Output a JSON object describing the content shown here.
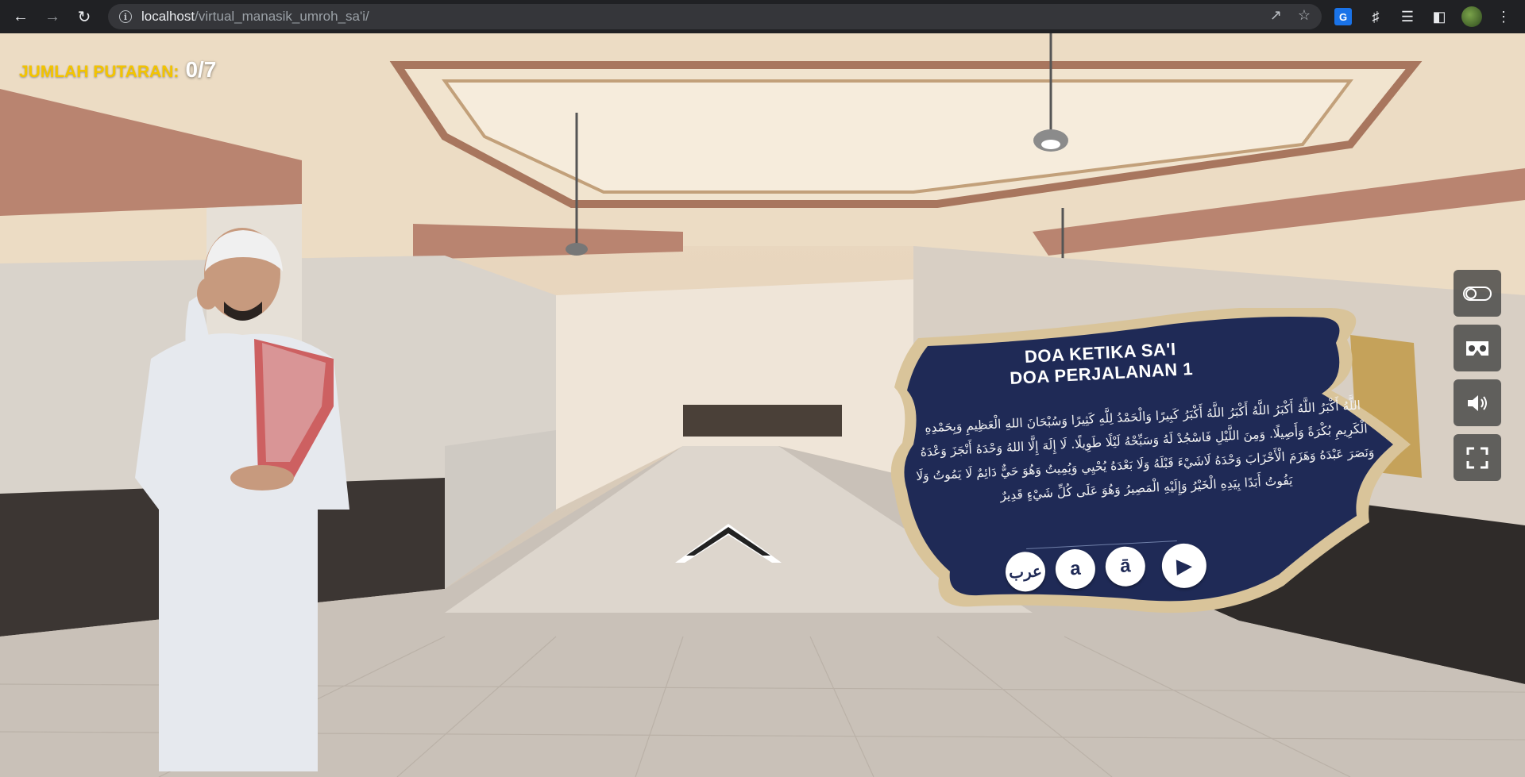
{
  "browser": {
    "url_host": "localhost",
    "url_path": "/virtual_manasik_umroh_sa'i/"
  },
  "counter": {
    "label": "JUMLAH PUTARAN:",
    "value": "0/7"
  },
  "side_controls": [
    {
      "name": "toggle-icon"
    },
    {
      "name": "vr-headset-icon"
    },
    {
      "name": "volume-icon"
    },
    {
      "name": "fullscreen-icon"
    }
  ],
  "prayer_panel": {
    "title_line1": "DOA KETIKA SA'I",
    "title_line2": "DOA PERJALANAN 1",
    "arabic_text": "اللَّهُ أَكْبَرُ اللَّهُ أَكْبَرُ اللَّهُ أَكْبَرُ اللَّهُ أَكْبَرُ كَبِيرًا وَالْحَمْدُ لِلَّهِ كَثِيرًا وَسُبْحَانَ اللهِ الْعَظِيمِ وَبِحَمْدِهِ الْكَرِيمِ بُكْرَةً وَأَصِيلًا. وَمِنَ اللَّيْلِ فَاسْجُدْ لَهُ وَسَبِّحْهُ لَيْلًا طَوِيلًا. لَا إِلَهَ إِلَّا اللهُ وَحْدَهُ أَنْجَزَ وَعْدَهُ وَنَصَرَ عَبْدَهُ وَهَزَمَ الْأَحْزَابَ وَحْدَهُ لَاشَيْءَ قَبْلَهُ وَلَا بَعْدَهُ يُحْيِي وَيُمِيتُ وَهُوَ حَيٌّ دَائِمٌ لَا يَمُوتُ وَلَا يَفُوتُ أَبَدًا بِيَدِهِ الْخَيْرُ وَإِلَيْهِ الْمَصِيرُ وَهُوَ عَلَى كُلِّ شَيْءٍ قَدِيرٌ",
    "buttons": {
      "arabic": "عرب",
      "latin": "a",
      "latin_long": "ā",
      "play": "▶"
    }
  },
  "colors": {
    "counter_label": "#f3c400",
    "panel_bg": "#1f2a56",
    "panel_border": "#d9c49a"
  }
}
